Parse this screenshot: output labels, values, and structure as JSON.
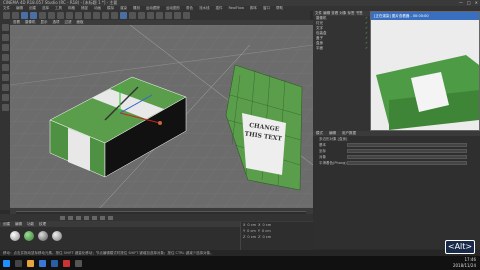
{
  "window": {
    "title": "CINEMA 4D R18.057 Studio (RC - R18) - [未标题 1 *] - 主要"
  },
  "menubar": {
    "items": [
      "文件",
      "编辑",
      "创建",
      "选择",
      "工具",
      "网格",
      "捕捉",
      "动画",
      "模拟",
      "渲染",
      "雕刻",
      "运动跟踪",
      "运动图形",
      "角色",
      "流水线",
      "插件",
      "RealFlow",
      "脚本",
      "窗口",
      "帮助"
    ]
  },
  "viewport": {
    "menu": [
      "查看",
      "摄像机",
      "显示",
      "选项",
      "过滤",
      "面板"
    ],
    "label_text": "CHANGE THIS TEXT"
  },
  "object_manager": {
    "title": "文件 编辑 查看 对象 标签 书签",
    "objects": [
      "摄像机",
      "灯光",
      "文字",
      "包装盒",
      "盖子",
      "盒身",
      "平面"
    ]
  },
  "preview": {
    "title": "[正在渲染] 图片查看器 - 00:00:00"
  },
  "attribute_manager": {
    "tabs": [
      "模式",
      "编辑",
      "用户数据"
    ],
    "title": "多边形对象 [盒身]",
    "rows": [
      "基本",
      "坐标",
      "对象",
      "平滑着色(Phong)"
    ]
  },
  "materials": {
    "menu": [
      "创建",
      "编辑",
      "功能",
      "纹理"
    ]
  },
  "coords": {
    "rows": [
      [
        "X",
        "0 cm",
        "X",
        "0 cm"
      ],
      [
        "Y",
        "0 cm",
        "Y",
        "0 cm"
      ],
      [
        "Z",
        "0 cm",
        "Z",
        "0 cm"
      ]
    ]
  },
  "status": {
    "text": "移动：点击并拖动鼠标移动元素。按住 SHIFT 键量化移动；节点编辑模式时按住 SHIFT 键增加选择对象；按住 CTRL 键减少选择对象。"
  },
  "clock": {
    "time": "17:46",
    "date": "2018/11/24"
  },
  "keycast": {
    "label": "<Alt>"
  },
  "colors": {
    "accent": "#3a6fc0",
    "box_green": "#5a9e4c",
    "viewport_bg": "#6c6c6c"
  }
}
